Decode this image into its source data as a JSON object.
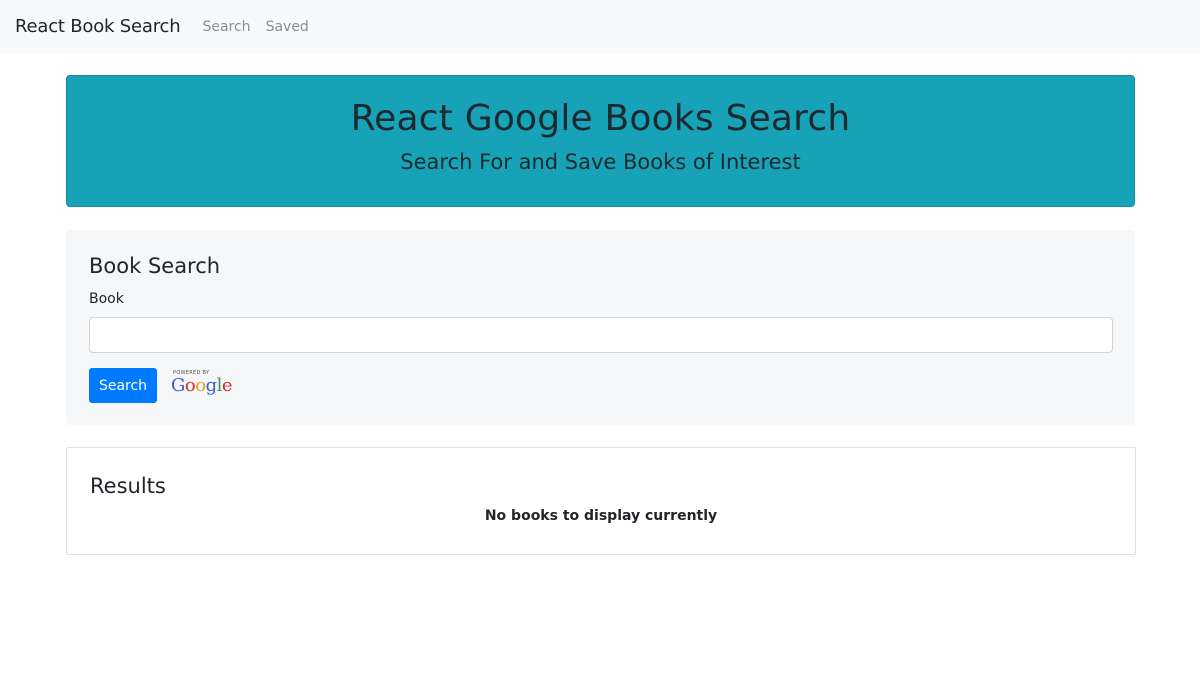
{
  "navbar": {
    "brand": "React Book Search",
    "links": [
      "Search",
      "Saved"
    ]
  },
  "jumbotron": {
    "title": "React Google Books Search",
    "subtitle": "Search For and Save Books of Interest"
  },
  "search_card": {
    "title": "Book Search",
    "field_label": "Book",
    "input_value": "",
    "input_placeholder": "",
    "button_label": "Search",
    "attribution": {
      "powered_by": "POWERED BY",
      "letters": [
        "G",
        "o",
        "o",
        "g",
        "l",
        "e"
      ]
    }
  },
  "results": {
    "title": "Results",
    "empty_message": "No books to display currently"
  },
  "colors": {
    "accent": "#17a2b8",
    "button": "#007bff",
    "google": [
      "#3b5bdb",
      "#d0312d",
      "#e8a317",
      "#3b5bdb",
      "#2e9c44",
      "#d0312d"
    ]
  }
}
